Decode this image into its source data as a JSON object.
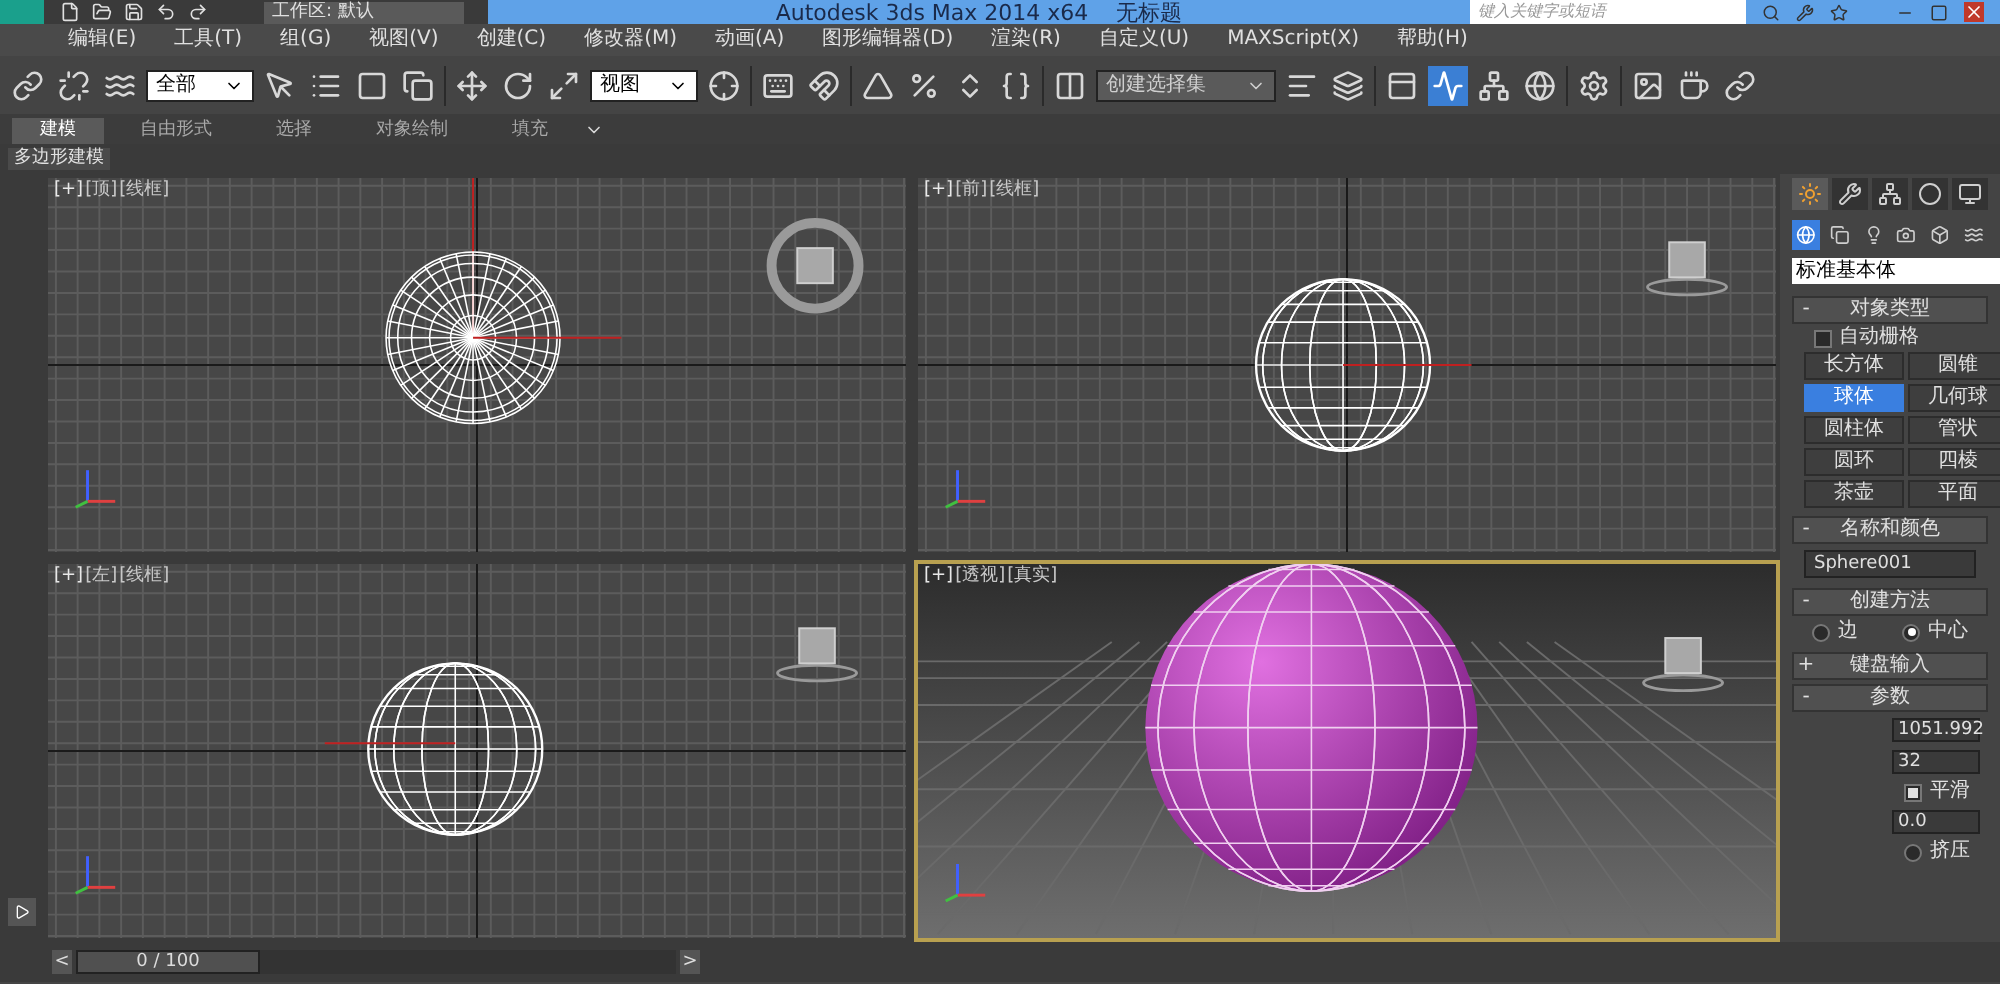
{
  "title_bar": {
    "workspace": "工作区: 默认",
    "title": "Autodesk 3ds Max  2014 x64",
    "document": "无标题",
    "search": {
      "placeholder": "键入关键字或短语"
    }
  },
  "menu": [
    "编辑(E)",
    "工具(T)",
    "组(G)",
    "视图(V)",
    "创建(C)",
    "修改器(M)",
    "动画(A)",
    "图形编辑器(D)",
    "渲染(R)",
    "自定义(U)",
    "MAXScript(X)",
    "帮助(H)"
  ],
  "toolbar": [
    {
      "kind": "icon",
      "selected": false
    },
    {
      "kind": "icon",
      "selected": false
    },
    {
      "kind": "icon",
      "selected": false
    },
    {
      "kind": "dropdown",
      "value": "全部"
    },
    {
      "kind": "icon",
      "selected": false
    },
    {
      "kind": "icon",
      "selected": false
    },
    {
      "kind": "icon",
      "selected": false
    },
    {
      "kind": "icon",
      "selected": false
    },
    {
      "kind": "sep"
    },
    {
      "kind": "icon",
      "selected": false
    },
    {
      "kind": "icon",
      "selected": false
    },
    {
      "kind": "icon",
      "selected": false
    },
    {
      "kind": "dropdown",
      "value": "视图"
    },
    {
      "kind": "icon",
      "selected": false
    },
    {
      "kind": "sep"
    },
    {
      "kind": "icon",
      "selected": false
    },
    {
      "kind": "icon",
      "selected": false
    },
    {
      "kind": "sep"
    },
    {
      "kind": "icon",
      "selected": false
    },
    {
      "kind": "icon",
      "selected": false
    },
    {
      "kind": "icon",
      "selected": false
    },
    {
      "kind": "icon",
      "selected": false
    },
    {
      "kind": "sep"
    },
    {
      "kind": "icon",
      "selected": false
    },
    {
      "kind": "dropdown",
      "value": "创建选择集"
    },
    {
      "kind": "icon",
      "selected": false
    },
    {
      "kind": "icon",
      "selected": false
    },
    {
      "kind": "sep"
    },
    {
      "kind": "icon",
      "selected": false
    },
    {
      "kind": "icon",
      "selected": true
    },
    {
      "kind": "icon",
      "selected": false
    },
    {
      "kind": "icon",
      "selected": false
    },
    {
      "kind": "sep"
    },
    {
      "kind": "icon",
      "selected": false
    },
    {
      "kind": "sep"
    },
    {
      "kind": "icon",
      "selected": false
    },
    {
      "kind": "icon",
      "selected": false
    },
    {
      "kind": "icon",
      "selected": false
    }
  ],
  "ribbon_tabs": [
    {
      "label": "建模",
      "selected": true
    },
    {
      "label": "自由形式",
      "selected": false
    },
    {
      "label": "选择",
      "selected": false
    },
    {
      "label": "对象绘制",
      "selected": false
    },
    {
      "label": "填充",
      "selected": false
    }
  ],
  "ribbon_panel": "多边形建模",
  "viewports": [
    {
      "kind": "top",
      "labels": [
        "[+]",
        "[顶]",
        "[线框]"
      ],
      "selected": false
    },
    {
      "kind": "front",
      "labels": [
        "[+]",
        "[前]",
        "[线框]"
      ],
      "selected": false
    },
    {
      "kind": "left",
      "labels": [
        "[+]",
        "[左]",
        "[线框]"
      ],
      "selected": false
    },
    {
      "kind": "perspective",
      "labels": [
        "[+]",
        "[透视]",
        "[真实]"
      ],
      "selected": true
    }
  ],
  "command_panel": {
    "tabs": [
      {
        "selected": true
      },
      {
        "selected": false
      },
      {
        "selected": false
      },
      {
        "selected": false
      },
      {
        "selected": false
      }
    ],
    "categories": [
      {
        "selected": true
      },
      {
        "selected": false
      },
      {
        "selected": false
      },
      {
        "selected": false
      },
      {
        "selected": false
      },
      {
        "selected": false
      }
    ],
    "type_dropdown": "标准基本体",
    "rollouts": [
      {
        "kind": "object_type",
        "toggle": "-",
        "title": "对象类型",
        "autogrid": {
          "label": "自动栅格",
          "checked": false
        },
        "buttons": [
          {
            "label": "长方体",
            "selected": false
          },
          {
            "label": "圆锥",
            "selected": false
          },
          {
            "label": "球体",
            "selected": true
          },
          {
            "label": "几何球",
            "selected": false
          },
          {
            "label": "圆柱体",
            "selected": false
          },
          {
            "label": "管状",
            "selected": false
          },
          {
            "label": "圆环",
            "selected": false
          },
          {
            "label": "四棱",
            "selected": false
          },
          {
            "label": "茶壶",
            "selected": false
          },
          {
            "label": "平面",
            "selected": false
          }
        ]
      },
      {
        "kind": "name",
        "toggle": "-",
        "title": "名称和颜色",
        "value": "Sphere001"
      },
      {
        "kind": "method",
        "toggle": "-",
        "title": "创建方法",
        "options": [
          {
            "label": "边",
            "selected": false
          },
          {
            "label": "中心",
            "selected": true
          }
        ]
      },
      {
        "kind": "collapsed",
        "toggle": "+",
        "title": "键盘输入"
      },
      {
        "kind": "params",
        "toggle": "-",
        "title": "参数",
        "fields": [
          "1051.992",
          "32"
        ],
        "smooth": {
          "label": "平滑",
          "checked": true
        },
        "field2": "0.0",
        "squash": {
          "label": "挤压",
          "selected": false
        }
      }
    ]
  },
  "time_slider": {
    "prev": "<",
    "label": "0 / 100",
    "level": 0,
    "next": ">"
  }
}
